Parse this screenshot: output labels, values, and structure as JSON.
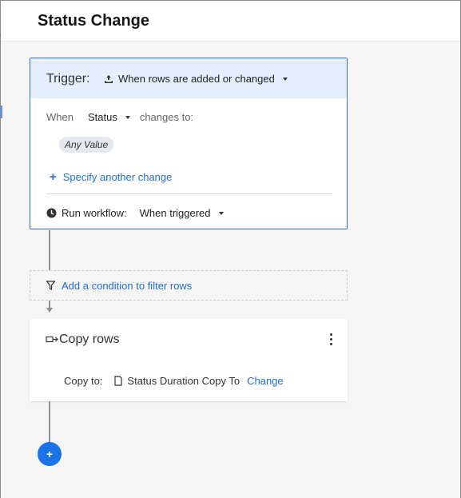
{
  "header": {
    "title": "Status Change"
  },
  "trigger": {
    "label": "Trigger:",
    "selected": "When rows are added or changed",
    "when_label": "When",
    "field": "Status",
    "changes_to_label": "changes to:",
    "value_pill": "Any Value",
    "specify_label": "Specify another change",
    "run_label": "Run workflow:",
    "run_value": "When triggered"
  },
  "condition": {
    "label": "Add a condition to filter rows"
  },
  "action": {
    "title": "Copy rows",
    "copy_to_label": "Copy to:",
    "sheet_name": "Status Duration Copy To",
    "change_label": "Change"
  },
  "add_button": {
    "label": "+"
  },
  "colors": {
    "accent": "#1f6ed4",
    "trigger_bg": "#e3effc",
    "add_button": "#1a73e8"
  },
  "icons": [
    "upload-rows-icon",
    "caret-down-icon",
    "clock-icon",
    "filter-icon",
    "copy-rows-icon",
    "document-icon",
    "kebab-menu-icon",
    "plus-icon"
  ]
}
